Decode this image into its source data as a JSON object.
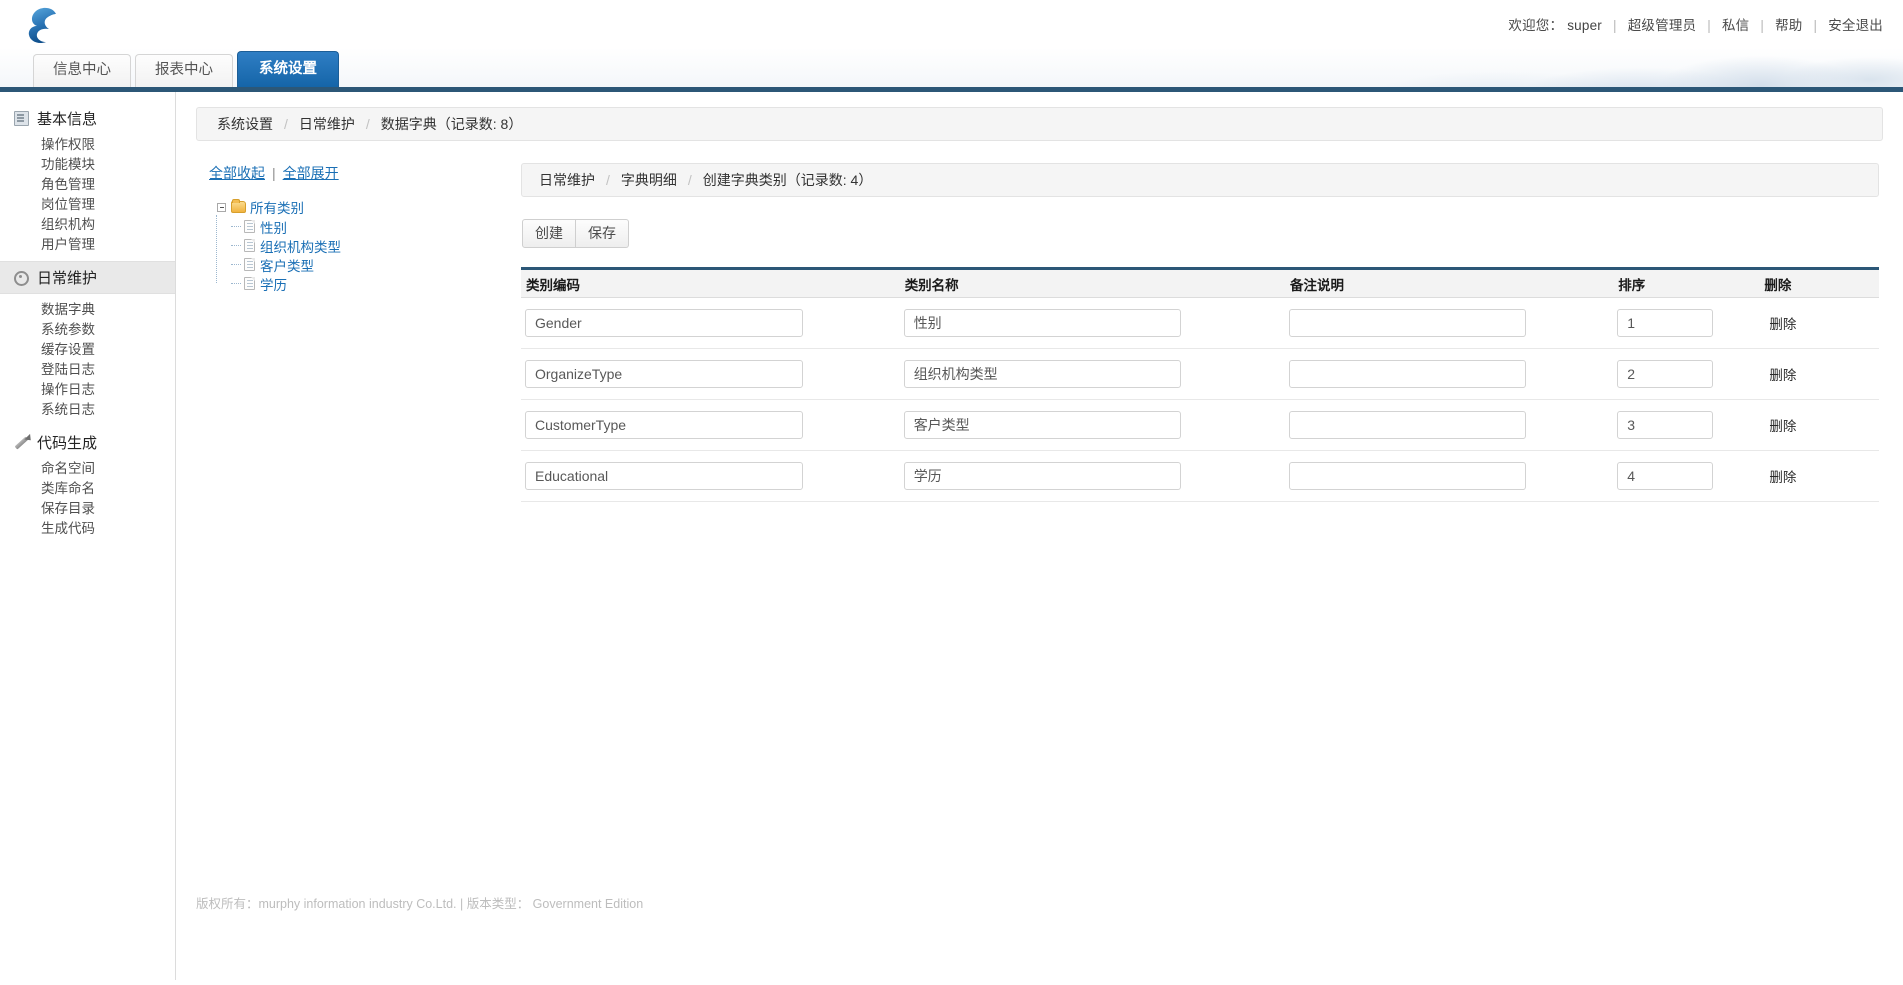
{
  "header": {
    "logo_name": "cloud-logo",
    "welcome_prefix": "欢迎您：",
    "username": "super",
    "links": [
      "超级管理员",
      "私信",
      "帮助",
      "安全退出"
    ],
    "separator": "|"
  },
  "tabs": [
    {
      "label": "信息中心",
      "active": false
    },
    {
      "label": "报表中心",
      "active": false
    },
    {
      "label": "系统设置",
      "active": true
    }
  ],
  "sidebar": {
    "groups": [
      {
        "label": "基本信息",
        "icon": "document-icon",
        "highlighted": false,
        "items": [
          "操作权限",
          "功能模块",
          "角色管理",
          "岗位管理",
          "组织机构",
          "用户管理"
        ]
      },
      {
        "label": "日常维护",
        "icon": "gear-icon",
        "highlighted": true,
        "items": [
          "数据字典",
          "系统参数",
          "缓存设置",
          "登陆日志",
          "操作日志",
          "系统日志"
        ]
      },
      {
        "label": "代码生成",
        "icon": "pencil-icon",
        "highlighted": false,
        "items": [
          "命名空间",
          "类库命名",
          "保存目录",
          "生成代码"
        ]
      }
    ]
  },
  "breadcrumb": {
    "separator": "/",
    "items": [
      "系统设置",
      "日常维护",
      "数据字典（记录数: 8）"
    ]
  },
  "tree": {
    "collapse_all": "全部收起",
    "expand_all": "全部展开",
    "divider": "|",
    "root": {
      "label": "所有类别",
      "icon": "folder-icon",
      "expanded": true
    },
    "nodes": [
      {
        "label": "性别",
        "icon": "page-icon"
      },
      {
        "label": "组织机构类型",
        "icon": "page-icon"
      },
      {
        "label": "客户类型",
        "icon": "page-icon"
      },
      {
        "label": "学历",
        "icon": "page-icon"
      }
    ]
  },
  "panel": {
    "breadcrumb": {
      "separator": "/",
      "items": [
        "日常维护",
        "字典明细",
        "创建字典类别（记录数: 4）"
      ]
    },
    "buttons": [
      {
        "label": "创建",
        "name": "create-button"
      },
      {
        "label": "保存",
        "name": "save-button"
      }
    ],
    "table": {
      "headers": [
        "类别编码",
        "类别名称",
        "备注说明",
        "排序",
        "删除"
      ],
      "delete_label": "删除",
      "rows": [
        {
          "code": "Gender",
          "name": "性别",
          "memo": "",
          "sort": "1"
        },
        {
          "code": "OrganizeType",
          "name": "组织机构类型",
          "memo": "",
          "sort": "2"
        },
        {
          "code": "CustomerType",
          "name": "客户类型",
          "memo": "",
          "sort": "3"
        },
        {
          "code": "Educational",
          "name": "学历",
          "memo": "",
          "sort": "4"
        }
      ]
    }
  },
  "footer": {
    "text": "版权所有：murphy information industry Co.Ltd. | 版本类型： Government Edition"
  },
  "colors": {
    "accent": "#1565a8",
    "rule": "#2c5777",
    "link": "#1a6fb5"
  }
}
